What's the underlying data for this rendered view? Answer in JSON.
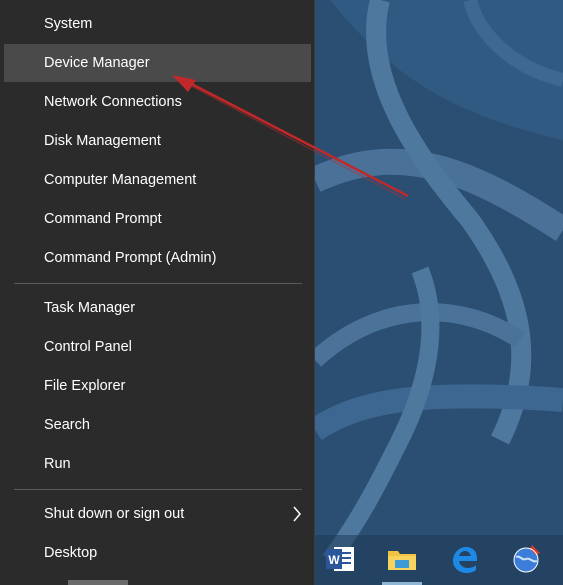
{
  "menu": {
    "items": [
      {
        "label": "System"
      },
      {
        "label": "Device Manager"
      },
      {
        "label": "Network Connections"
      },
      {
        "label": "Disk Management"
      },
      {
        "label": "Computer Management"
      },
      {
        "label": "Command Prompt"
      },
      {
        "label": "Command Prompt (Admin)"
      },
      {
        "label": "Task Manager"
      },
      {
        "label": "Control Panel"
      },
      {
        "label": "File Explorer"
      },
      {
        "label": "Search"
      },
      {
        "label": "Run"
      },
      {
        "label": "Shut down or sign out"
      },
      {
        "label": "Desktop"
      }
    ],
    "highlighted_item": "Device Manager"
  },
  "taskbar": {
    "icons": [
      "word-icon",
      "file-explorer-icon",
      "edge-icon",
      "globe-app-icon"
    ]
  },
  "colors": {
    "menu_bg": "#2b2b2b",
    "highlight_bg": "#4a4a4a",
    "desktop_bg": "#2b4f72",
    "annotation_arrow": "#c0282a"
  }
}
